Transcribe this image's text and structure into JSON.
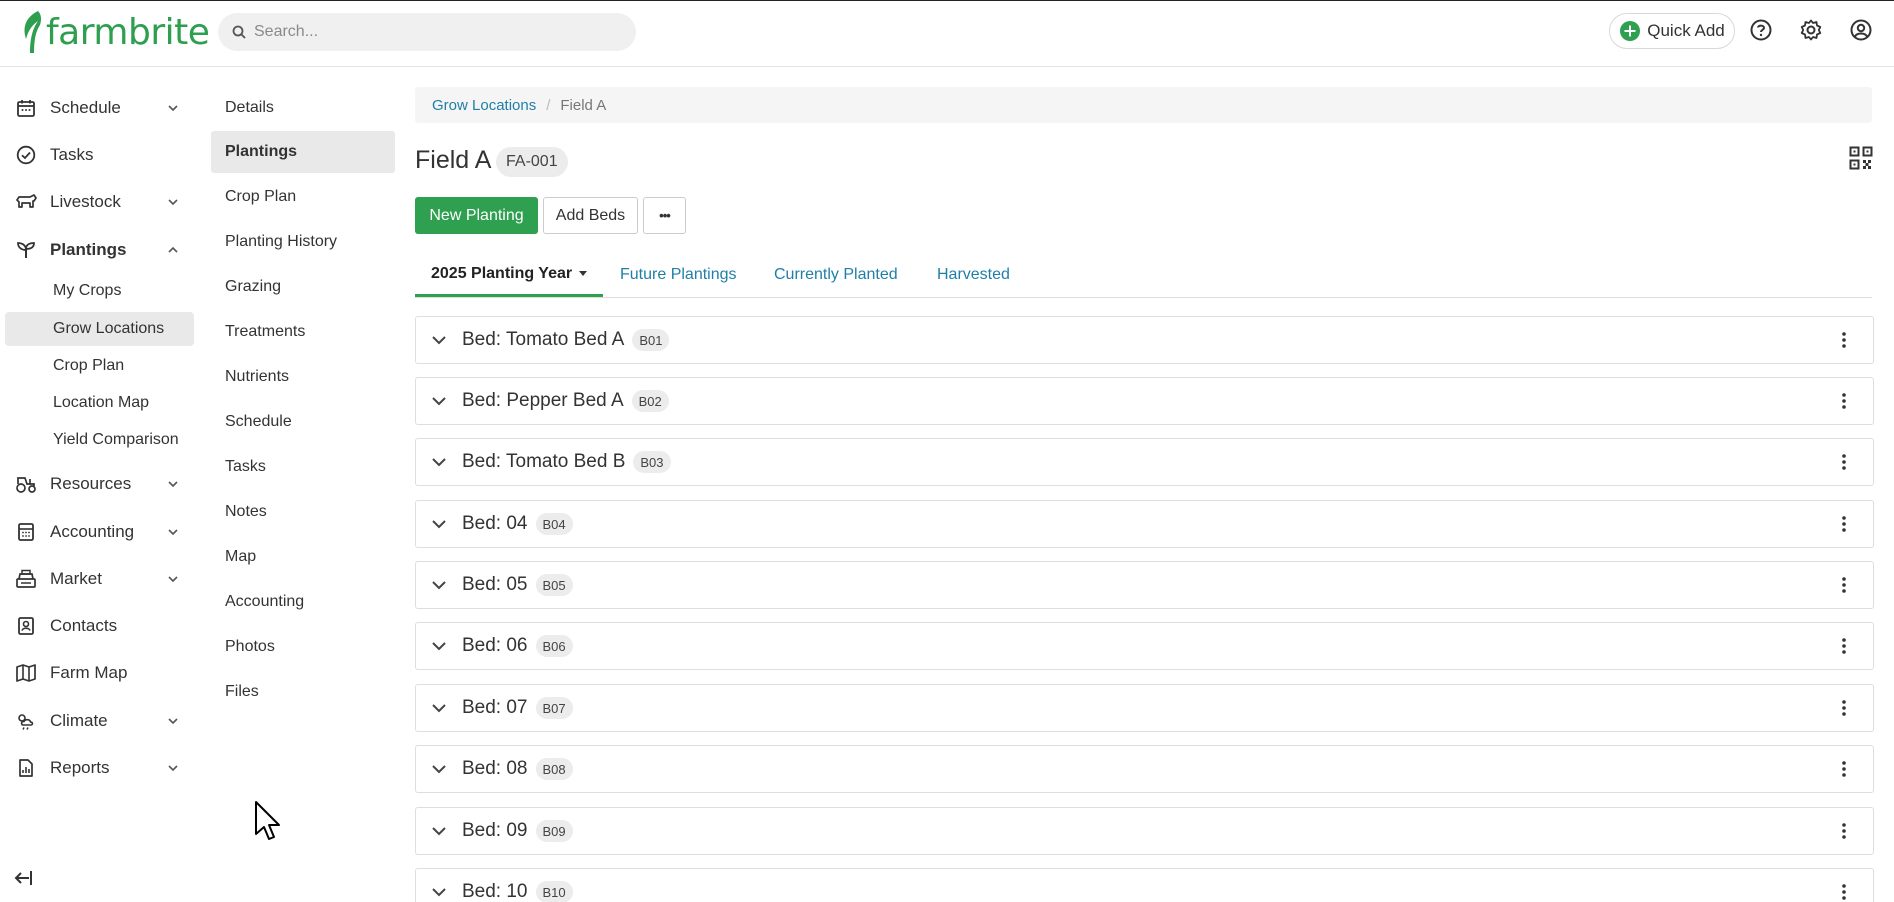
{
  "app": {
    "logo_text": "farmbrite",
    "brand_color": "#2e9e4f",
    "link_color": "#1f7fa6"
  },
  "header": {
    "search_placeholder": "Search...",
    "quick_add_label": "Quick Add"
  },
  "leftnav": {
    "schedule": "Schedule",
    "tasks": "Tasks",
    "livestock": "Livestock",
    "plantings": "Plantings",
    "plantings_sub": {
      "my_crops": "My Crops",
      "grow_locations": "Grow Locations",
      "crop_plan": "Crop Plan",
      "location_map": "Location Map",
      "yield_comparison": "Yield Comparison"
    },
    "resources": "Resources",
    "accounting": "Accounting",
    "market": "Market",
    "contacts": "Contacts",
    "farm_map": "Farm Map",
    "climate": "Climate",
    "reports": "Reports"
  },
  "subnav": {
    "details": "Details",
    "plantings": "Plantings",
    "crop_plan": "Crop Plan",
    "planting_history": "Planting History",
    "grazing": "Grazing",
    "treatments": "Treatments",
    "nutrients": "Nutrients",
    "schedule": "Schedule",
    "tasks": "Tasks",
    "notes": "Notes",
    "map": "Map",
    "accounting": "Accounting",
    "photos": "Photos",
    "files": "Files"
  },
  "breadcrumb": {
    "parent": "Grow Locations",
    "current": "Field A"
  },
  "location": {
    "name": "Field A",
    "code": "FA-001"
  },
  "actions": {
    "new_planting": "New Planting",
    "add_beds": "Add Beds",
    "more": "•••"
  },
  "tabs": {
    "year": "2025 Planting Year",
    "future": "Future Plantings",
    "current": "Currently Planted",
    "harvested": "Harvested"
  },
  "beds": [
    {
      "name": "Bed: Tomato Bed A",
      "code": "B01"
    },
    {
      "name": "Bed: Pepper Bed A",
      "code": "B02"
    },
    {
      "name": "Bed: Tomato Bed B",
      "code": "B03"
    },
    {
      "name": "Bed: 04",
      "code": "B04"
    },
    {
      "name": "Bed: 05",
      "code": "B05"
    },
    {
      "name": "Bed: 06",
      "code": "B06"
    },
    {
      "name": "Bed: 07",
      "code": "B07"
    },
    {
      "name": "Bed: 08",
      "code": "B08"
    },
    {
      "name": "Bed: 09",
      "code": "B09"
    },
    {
      "name": "Bed: 10",
      "code": "B10"
    }
  ]
}
